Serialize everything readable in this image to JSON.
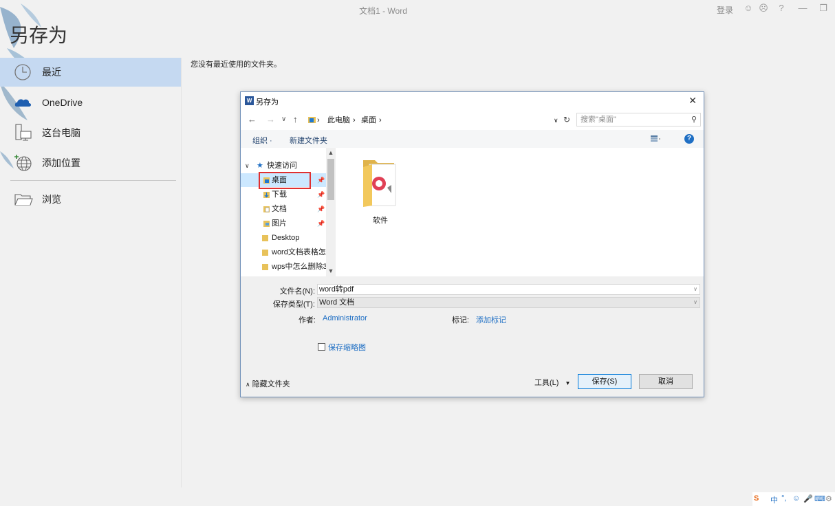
{
  "window": {
    "title": "文档1  -  Word",
    "signin": "登录"
  },
  "backstage": {
    "title": "另存为",
    "nav": [
      {
        "label": "最近",
        "icon": "clock-icon"
      },
      {
        "label": "OneDrive",
        "icon": "cloud-icon"
      },
      {
        "label": "这台电脑",
        "icon": "computer-icon"
      },
      {
        "label": "添加位置",
        "icon": "globe-add-icon"
      },
      {
        "label": "浏览",
        "icon": "folder-open-icon"
      }
    ],
    "recent_message": "您没有最近使用的文件夹。"
  },
  "dialog": {
    "title": "另存为",
    "address": [
      "此电脑",
      "桌面"
    ],
    "search_placeholder": "搜索\"桌面\"",
    "toolbar": {
      "organize": "组织 ·",
      "new_folder": "新建文件夹"
    },
    "tree": {
      "quick_access": "快速访问",
      "items": [
        {
          "label": "桌面",
          "pinned": true
        },
        {
          "label": "下载",
          "pinned": true
        },
        {
          "label": "文档",
          "pinned": true
        },
        {
          "label": "图片",
          "pinned": true
        },
        {
          "label": "Desktop",
          "pinned": false
        },
        {
          "label": "word文档表格怎",
          "pinned": false
        },
        {
          "label": "wps中怎么删除3",
          "pinned": false
        }
      ]
    },
    "files": [
      {
        "name": "软件"
      }
    ],
    "form": {
      "filename_label": "文件名(N):",
      "filename_value": "word转pdf",
      "filetype_label": "保存类型(T):",
      "filetype_value": "Word 文档",
      "author_label": "作者:",
      "author_value": "Administrator",
      "tags_label": "标记:",
      "tags_value": "添加标记",
      "thumbnail_label": "保存缩略图",
      "hide_folders": "隐藏文件夹",
      "tools": "工具(L)",
      "save": "保存(S)",
      "cancel": "取消"
    }
  },
  "ime": {
    "lang": "中"
  }
}
